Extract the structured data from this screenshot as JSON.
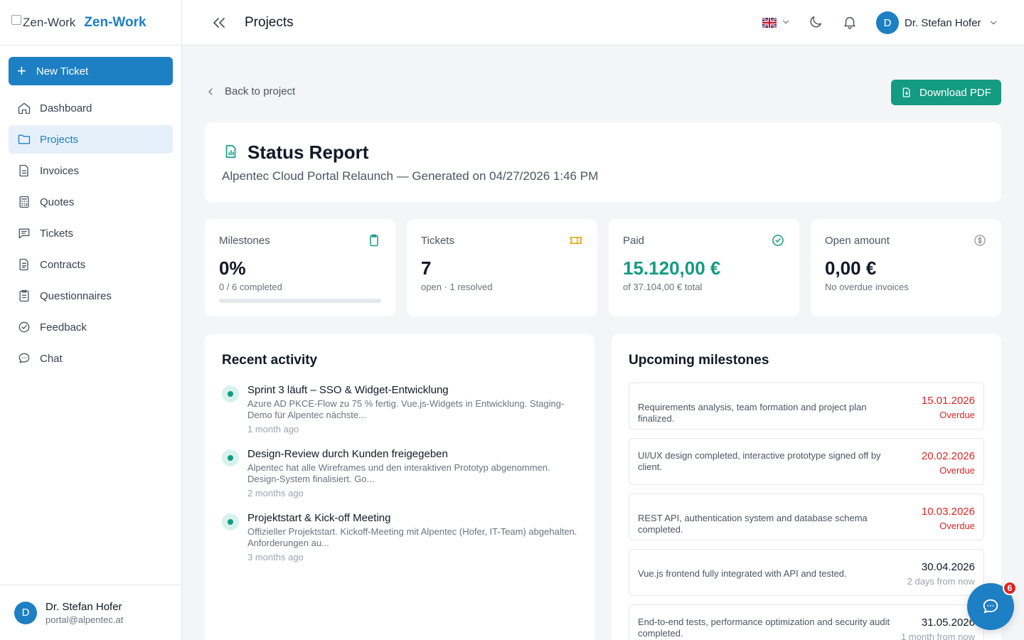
{
  "brand": {
    "logo_alt": "Zen-Work",
    "name": "Zen-Work"
  },
  "sidebar": {
    "new_ticket": "New Ticket",
    "items": [
      {
        "label": "Dashboard",
        "icon": "home-icon"
      },
      {
        "label": "Projects",
        "icon": "folder-icon"
      },
      {
        "label": "Invoices",
        "icon": "document-icon"
      },
      {
        "label": "Quotes",
        "icon": "calculator-icon"
      },
      {
        "label": "Tickets",
        "icon": "message-square-icon"
      },
      {
        "label": "Contracts",
        "icon": "file-text-icon"
      },
      {
        "label": "Questionnaires",
        "icon": "clipboard-list-icon"
      },
      {
        "label": "Feedback",
        "icon": "check-circle-icon"
      },
      {
        "label": "Chat",
        "icon": "chat-bubble-icon"
      }
    ],
    "user": {
      "initial": "D",
      "name": "Dr. Stefan Hofer",
      "email": "portal@alpentec.at"
    }
  },
  "topbar": {
    "title": "Projects",
    "user": {
      "initial": "D",
      "name": "Dr. Stefan Hofer"
    }
  },
  "main": {
    "back_label": "Back to project",
    "download_pdf": "Download PDF",
    "report": {
      "title": "Status Report",
      "subtitle": "Alpentec Cloud Portal Relaunch — Generated on 04/27/2026 1:46 PM"
    },
    "stats": {
      "milestones": {
        "label": "Milestones",
        "value": "0%",
        "sub": "0 / 6 completed",
        "progress": 0
      },
      "tickets": {
        "label": "Tickets",
        "value": "7",
        "sub": "open · 1 resolved"
      },
      "paid": {
        "label": "Paid",
        "value": "15.120,00 €",
        "sub": "of 37.104,00 € total"
      },
      "open_amount": {
        "label": "Open amount",
        "value": "0,00 €",
        "sub": "No overdue invoices"
      }
    },
    "activity": {
      "title": "Recent activity",
      "items": [
        {
          "title": "Sprint 3 läuft – SSO & Widget-Entwicklung",
          "desc": "Azure AD PKCE-Flow zu 75 % fertig. Vue.js-Widgets in Entwicklung. Staging-Demo für Alpentec nächste...",
          "when": "1 month ago"
        },
        {
          "title": "Design-Review durch Kunden freigegeben",
          "desc": "Alpentec hat alle Wireframes und den interaktiven Prototyp abgenommen. Design-System finalisiert. Go...",
          "when": "2 months ago"
        },
        {
          "title": "Projektstart & Kick-off Meeting",
          "desc": "Offizieller Projektstart. Kickoff-Meeting mit Alpentec (Hofer, IT-Team) abgehalten. Anforderungen au...",
          "when": "3 months ago"
        }
      ]
    },
    "milestones": {
      "title": "Upcoming milestones",
      "items": [
        {
          "desc": "Requirements analysis, team formation and project plan finalized.",
          "date": "15.01.2026",
          "rel": "Overdue"
        },
        {
          "desc": "UI/UX design completed, interactive prototype signed off by client.",
          "date": "20.02.2026",
          "rel": "Overdue"
        },
        {
          "desc": "REST API, authentication system and database schema completed.",
          "date": "10.03.2026",
          "rel": "Overdue"
        },
        {
          "desc": "Vue.js frontend fully integrated with API and tested.",
          "date": "30.04.2026",
          "rel": "2 days from now"
        },
        {
          "desc": "End-to-end tests, performance optimization and security audit completed.",
          "date": "31.05.2026",
          "rel": "1 month from now"
        }
      ]
    }
  },
  "chat": {
    "badge": "6"
  },
  "colors": {
    "primary": "#1d7fc4",
    "success": "#149b82",
    "danger": "#dc2626"
  }
}
